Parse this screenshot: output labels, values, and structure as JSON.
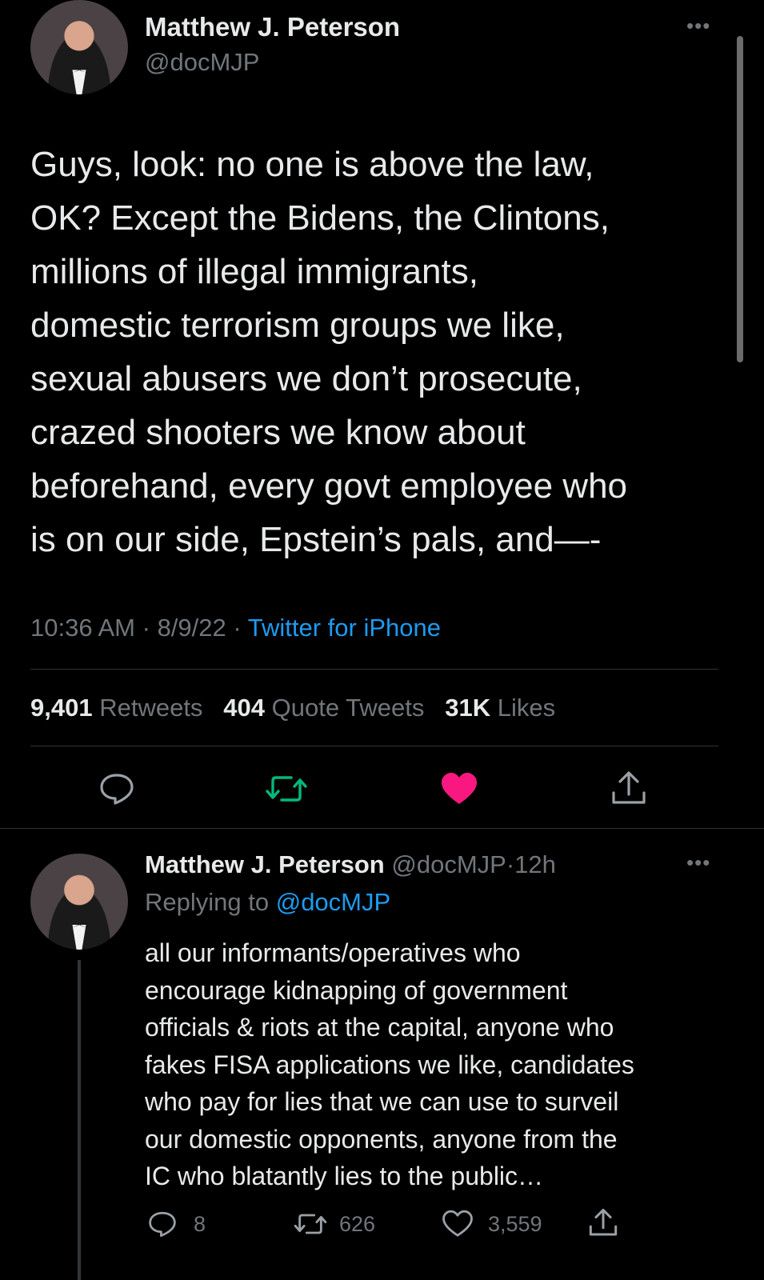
{
  "main_tweet": {
    "author_name": "Matthew J. Peterson",
    "author_handle": "@docMJP",
    "text_lines": [
      "Guys, look: no one is above the law,",
      "OK? Except the Bidens, the Clintons,",
      "millions of illegal immigrants,",
      "domestic terrorism groups we like,",
      "sexual abusers we don’t prosecute,",
      "crazed shooters we know about",
      "beforehand, every govt employee who",
      "is on our side, Epstein’s pals, and—-"
    ],
    "time": "10:36 AM",
    "date": "8/9/22",
    "separator": "·",
    "source": "Twitter for iPhone",
    "retweets_count": "9,401",
    "retweets_label": "Retweets",
    "quotes_count": "404",
    "quotes_label": "Quote Tweets",
    "likes_count": "31K",
    "likes_label": "Likes",
    "more_icon": "more-dots-icon",
    "actions": [
      "reply-icon",
      "retweet-icon",
      "like-icon",
      "share-icon"
    ]
  },
  "reply_tweet": {
    "author_name": "Matthew J. Peterson",
    "author_handle": "@docMJP",
    "separator": "·",
    "age": "12h",
    "replying_to_label": "Replying to",
    "replying_to_handle": "@docMJP",
    "text_lines": [
      "all our informants/operatives who",
      "encourage kidnapping of government",
      "officials & riots at the capital, anyone who",
      "fakes FISA applications we like, candidates",
      "who pay for lies that we can use to surveil",
      "our domestic opponents, anyone from the",
      "IC who blatantly lies to the public…"
    ],
    "reply_count": "8",
    "retweet_count": "626",
    "like_count": "3,559"
  },
  "colors": {
    "background": "#000000",
    "text": "#e7e9ea",
    "muted": "#71767b",
    "link": "#1d9bf0",
    "retweet_active": "#00ba7c",
    "like_active": "#f91880",
    "divider": "#2f3336"
  }
}
